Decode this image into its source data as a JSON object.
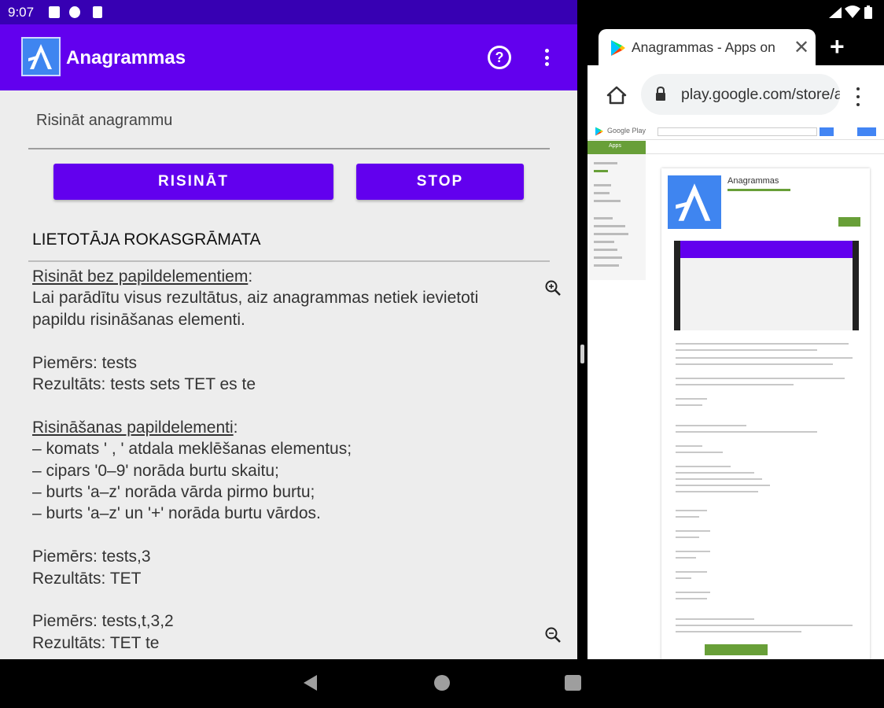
{
  "status_bar": {
    "time": "9:07"
  },
  "app": {
    "title": "Anagrammas",
    "icons": [
      "help-icon",
      "more-vert-icon"
    ],
    "input": {
      "placeholder": "Risināt anagrammu",
      "value": ""
    },
    "buttons": {
      "solve": "RISINĀT",
      "stop": "STOP"
    },
    "manual": {
      "title": "LIETOTĀJA ROKASGRĀMATA",
      "section1_heading": "Risināt bez papildelementiem",
      "section1_heading_suffix": ":",
      "section1_line1": "Lai parādītu visus rezultātus, aiz anagrammas netiek ievietoti",
      "section1_line2": "papildu risināšanas elementi.",
      "example1_query": "Piemērs: tests",
      "example1_result": "Rezultāts: tests sets TET es te",
      "section2_heading": "Risināšanas papildelementi",
      "section2_heading_suffix": ":",
      "rules": [
        "– komats ' , ' atdala meklēšanas elementus;",
        "– cipars '0–9' norāda burtu skaitu;",
        "– burts 'a–z' norāda vārda pirmo burtu;",
        "– burts 'a–z' un '+' norāda burtu vārdos."
      ],
      "example2_query": "Piemērs: tests,3",
      "example2_result": "Rezultāts: TET",
      "example3_query": "Piemērs: tests,t,3,2",
      "example3_result": "Rezultāts: TET te"
    }
  },
  "browser": {
    "tab_title": "Anagrammas - Apps on Google Play",
    "url": "play.google.com/store/apps",
    "page": {
      "store_name": "Google Play",
      "apps_tab": "Apps",
      "app_name": "Anagrammas"
    }
  },
  "colors": {
    "app_primary": "#6200ee",
    "status_bar_left": "#3700b3",
    "play_green": "#689f38"
  }
}
